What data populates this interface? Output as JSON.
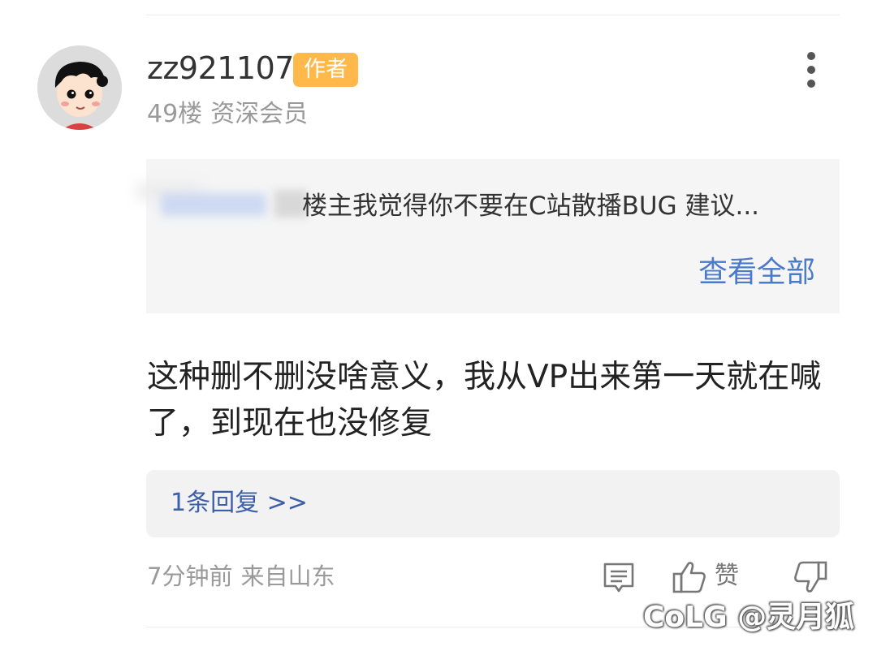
{
  "comment": {
    "username": "zz921107",
    "badge": "作者",
    "floor": "49楼",
    "level": "资深会员",
    "quote": {
      "text": "楼主我觉得你不要在C站散播BUG 建议...",
      "view_all": "查看全部"
    },
    "body": "这种删不删没啥意义，我从VP出来第一天就在喊了，到现在也没修复",
    "replies_link": "1条回复 >>",
    "time": "7分钟前",
    "location": "来自山东",
    "like_label": "赞"
  },
  "watermark": "CoLG @灵月狐",
  "icons": {
    "avatar": "cartoon-avatar",
    "more": "more-vertical-icon",
    "reply": "comment-icon",
    "like": "thumbs-up-icon",
    "dislike": "thumbs-down-icon"
  },
  "colors": {
    "badge": "#ffb84a",
    "link_blue": "#4a7ac9",
    "reply_blue": "#3d5ea8",
    "quote_bg": "#f5f5f5"
  }
}
